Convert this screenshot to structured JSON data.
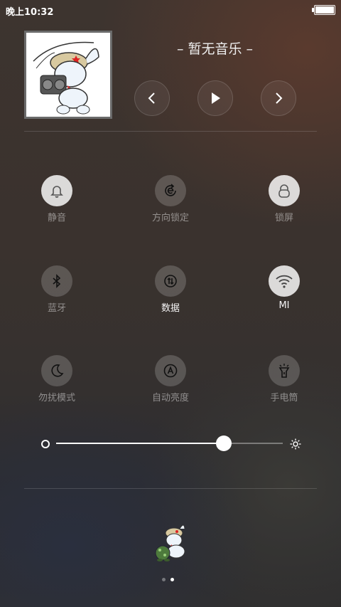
{
  "status_bar": {
    "time": "晚上10:32",
    "battery_level": 1.0
  },
  "music": {
    "title": "– 暂无音乐 –",
    "album_art": "cartoon-rabbit-radio",
    "controls": [
      "previous-icon",
      "play-icon",
      "next-icon"
    ]
  },
  "toggles": [
    {
      "label": "静音",
      "icon": "bell-icon",
      "state": "on"
    },
    {
      "label": "方向锁定",
      "icon": "rotation-lock-icon",
      "state": "off"
    },
    {
      "label": "锁屏",
      "icon": "lock-icon",
      "state": "on"
    },
    {
      "label": "蓝牙",
      "icon": "bluetooth-icon",
      "state": "off"
    },
    {
      "label": "数据",
      "icon": "mobile-data-icon",
      "state": "off",
      "label_active": true
    },
    {
      "label": "MI",
      "icon": "wifi-icon",
      "state": "on",
      "label_active": true
    },
    {
      "label": "勿扰模式",
      "icon": "moon-icon",
      "state": "off"
    },
    {
      "label": "自动亮度",
      "icon": "auto-brightness-icon",
      "state": "off"
    },
    {
      "label": "手电筒",
      "icon": "flashlight-icon",
      "state": "off"
    }
  ],
  "brightness": {
    "level_percent": 74
  },
  "pager": {
    "pages": 2,
    "current": 2
  }
}
